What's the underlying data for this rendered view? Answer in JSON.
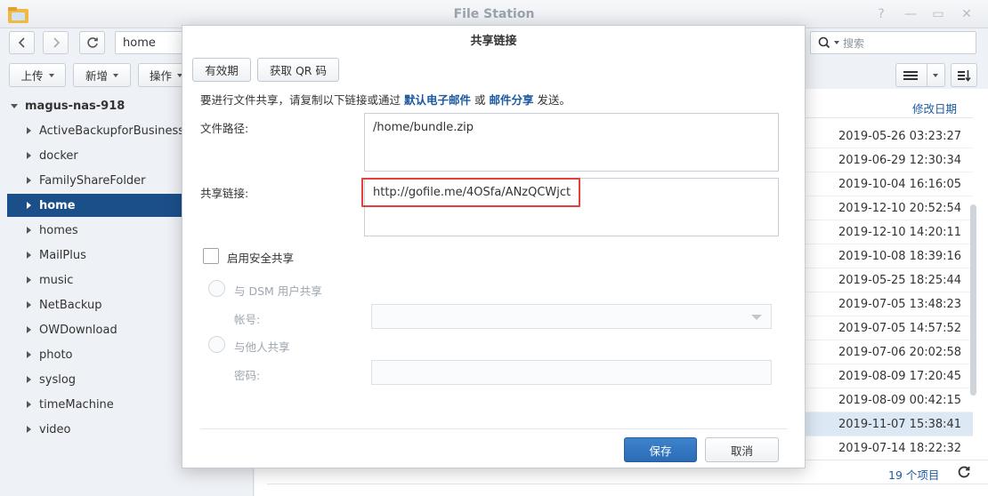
{
  "window": {
    "title": "File Station"
  },
  "toolbar": {
    "path": "home",
    "search_placeholder": "搜索",
    "upload_label": "上传",
    "create_label": "新增",
    "action_label": "操作"
  },
  "sidebar": {
    "root": "magus-nas-918",
    "items": [
      {
        "label": "ActiveBackupforBusiness"
      },
      {
        "label": "docker"
      },
      {
        "label": "FamilyShareFolder"
      },
      {
        "label": "home"
      },
      {
        "label": "homes"
      },
      {
        "label": "MailPlus"
      },
      {
        "label": "music"
      },
      {
        "label": "NetBackup"
      },
      {
        "label": "OWDownload"
      },
      {
        "label": "photo"
      },
      {
        "label": "syslog"
      },
      {
        "label": "timeMachine"
      },
      {
        "label": "video"
      }
    ],
    "selected": "home"
  },
  "file_list": {
    "column_modified": "修改日期",
    "dates": [
      "2019-05-26 03:23:27",
      "2019-06-29 12:30:34",
      "2019-10-04 16:16:05",
      "2019-12-10 20:52:54",
      "2019-12-10 14:20:11",
      "2019-10-08 18:39:16",
      "2019-05-25 18:25:44",
      "2019-07-05 13:48:23",
      "2019-07-05 14:57:52",
      "2019-07-06 20:02:58",
      "2019-08-09 17:20:45",
      "2019-08-09 00:42:15",
      "2019-11-07 15:38:41",
      "2019-07-14 18:22:32"
    ],
    "status": "19 个项目"
  },
  "dialog": {
    "title": "共享链接",
    "tab_validity": "有效期",
    "tab_qr": "获取 QR 码",
    "intro_prefix": "要进行文件共享，请复制以下链接或通过",
    "intro_email": "默认电子邮件",
    "intro_or": "或",
    "intro_mail_share": "邮件分享",
    "intro_suffix": "发送。",
    "path_label": "文件路径:",
    "path_value": "/home/bundle.zip",
    "link_label": "共享链接:",
    "link_value": "http://gofile.me/4OSfa/ANzQCWjct",
    "secure_share_label": "启用安全共享",
    "dsm_share_label": "与 DSM 用户共享",
    "account_label": "帐号:",
    "others_share_label": "与他人共享",
    "password_label": "密码:",
    "save_label": "保存",
    "cancel_label": "取消"
  },
  "colors": {
    "accent": "#1b4f8a",
    "link": "#1b5aa0",
    "highlight_border": "#e0413a",
    "primary_button": "#2b6cb5"
  }
}
